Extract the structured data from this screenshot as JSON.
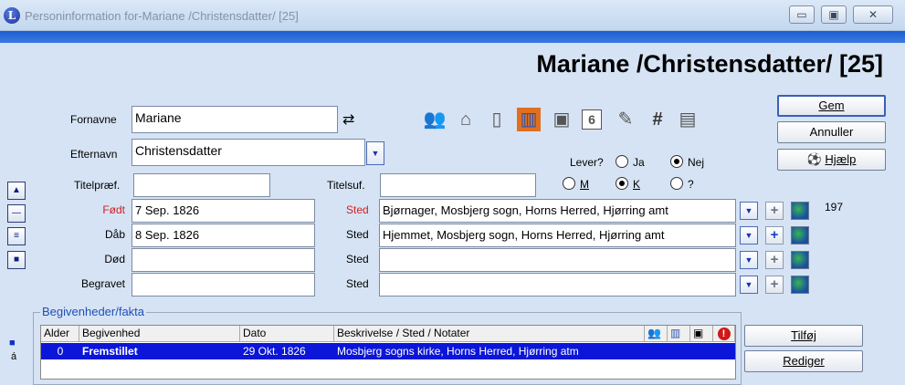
{
  "window": {
    "title": "Personinformation for-Mariane /Christensdatter/ [25]",
    "app_icon_letter": "L",
    "minimize_glyph": "▭",
    "maximize_glyph": "▣",
    "close_glyph": "✕"
  },
  "person_header": "Mariane /Christensdatter/ [25]",
  "fields": {
    "fornavne_label": "Fornavne",
    "fornavne_value": "Mariane",
    "efternavn_label": "Efternavn",
    "efternavn_value": "Christensdatter",
    "titelpraef_label": "Titelpræf.",
    "titelpraef_value": "",
    "titelsuf_label": "Titelsuf.",
    "titelsuf_value": ""
  },
  "lever": {
    "label": "Lever?",
    "options": [
      {
        "label": "Ja",
        "checked": false
      },
      {
        "label": "Nej",
        "checked": true
      }
    ]
  },
  "gender": {
    "options": [
      {
        "label": "M",
        "checked": false
      },
      {
        "label": "K",
        "checked": true
      },
      {
        "label": "?",
        "checked": false
      }
    ]
  },
  "events": [
    {
      "label": "Født",
      "value": "7 Sep. 1826",
      "place_label": "Sted",
      "place": "Bjørnager, Mosbjerg sogn, Horns Herred, Hjørring amt",
      "red": true
    },
    {
      "label": "Dåb",
      "value": "8 Sep. 1826",
      "place_label": "Sted",
      "place": "Hjemmet, Mosbjerg sogn, Horns Herred, Hjørring amt",
      "red": false
    },
    {
      "label": "Død",
      "value": "",
      "place_label": "Sted",
      "place": "",
      "red": false
    },
    {
      "label": "Begravet",
      "value": "",
      "place_label": "Sted",
      "place": "",
      "red": false
    }
  ],
  "count_197": "197",
  "buttons": {
    "gem": "Gem",
    "annuller": "Annuller",
    "hjaelp": "Hjælp",
    "tilfoej": "Tilføj",
    "rediger": "Rediger",
    "swap_glyph": "⇄",
    "dropdown_glyph": "▼",
    "plus_glyph": "+"
  },
  "side_buttons": [
    "▲",
    "—",
    "≡",
    "■"
  ],
  "bottom_left_glyphs": [
    "■",
    "á"
  ],
  "toolbar_icons": [
    "people-icon",
    "house-icon",
    "page-icon",
    "books-icon",
    "portraits-icon",
    "calendar-icon",
    "notes-icon",
    "hash-icon",
    "book-icon"
  ],
  "toolbar_glyphs": [
    "👥",
    "⌂",
    "▯",
    "▥",
    "▣",
    "6",
    "✎",
    "#",
    "▤"
  ],
  "facts": {
    "group_title": "Begivenheder/fakta",
    "columns": [
      "Alder",
      "Begivenhed",
      "Dato",
      "Beskrivelse / Sted / Notater"
    ],
    "header_icon_glyphs": [
      "👥",
      "▥",
      "▣",
      "!"
    ],
    "rows": [
      {
        "alder": "0",
        "begivenhed": "Fremstillet",
        "dato": "29 Okt. 1826",
        "beskrivelse": "Mosbjerg sogns kirke, Horns Herred, Hjørring atm"
      }
    ]
  },
  "colors": {
    "title_bar": "#c3d7ee",
    "blue_band": "#1c5fd1",
    "selection": "#0b16d8",
    "required_label": "#d12020"
  }
}
